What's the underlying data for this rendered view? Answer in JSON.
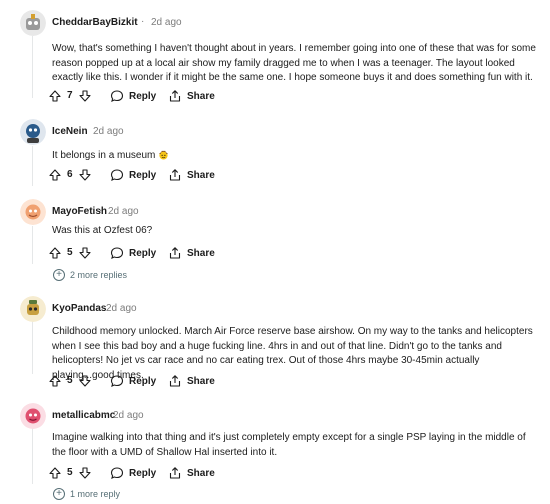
{
  "comments": [
    {
      "username": "CheddarBayBizkit",
      "time": "2d ago",
      "text": "Wow, that's something I haven't thought about in years. I remember going into one of these that was for some reason popped up at a local air show my family dragged me to when I was a teenager. The layout looked exactly like this. I wonder if it might be the same one. I hope someone buys it and does something fun with it.",
      "score": "7",
      "reply_label": "Reply",
      "share_label": "Share",
      "avatar_color": "#9a9a9a"
    },
    {
      "username": "IceNein",
      "time": "2d ago",
      "text": "It belongs in a museum",
      "score": "6",
      "reply_label": "Reply",
      "share_label": "Share",
      "avatar_color": "#2a5a8a"
    },
    {
      "username": "MayoFetish",
      "time": "2d ago",
      "text": "Was this at Ozfest 06?",
      "score": "5",
      "reply_label": "Reply",
      "share_label": "Share",
      "more_replies": "2 more replies",
      "avatar_color": "#f0a070"
    },
    {
      "username": "KyoPandas",
      "time": "2d ago",
      "text": "Childhood memory unlocked. March Air Force reserve base airshow. On my way to the tanks and helicopters when I see this bad boy and a huge fucking line. 4hrs in and out of that line. Didn't go to the tanks and helicopters! No jet vs car race and no car eating trex. Out of those 4hrs maybe 30-45min actually playing...good times.",
      "score": "5",
      "reply_label": "Reply",
      "share_label": "Share",
      "avatar_color": "#c8a040"
    },
    {
      "username": "metallicabmc",
      "time": "2d ago",
      "text": "Imagine walking into that thing and it's just completely empty except for a single PSP laying in the middle of the floor with a UMD of Shallow Hal inserted into it.",
      "score": "5",
      "reply_label": "Reply",
      "share_label": "Share",
      "more_replies": "1 more reply",
      "avatar_color": "#e05070"
    }
  ],
  "colors": {
    "text": "#1c1c1c",
    "muted": "#7c7c7c",
    "rail": "#e5e7e8",
    "link": "#576f76"
  },
  "icons": {
    "upvote": "arrow-up-icon",
    "downvote": "arrow-down-icon",
    "reply": "speech-bubble-icon",
    "share": "share-icon",
    "expand": "plus-circle-icon",
    "emoji": "cowboy-emoji-icon"
  }
}
